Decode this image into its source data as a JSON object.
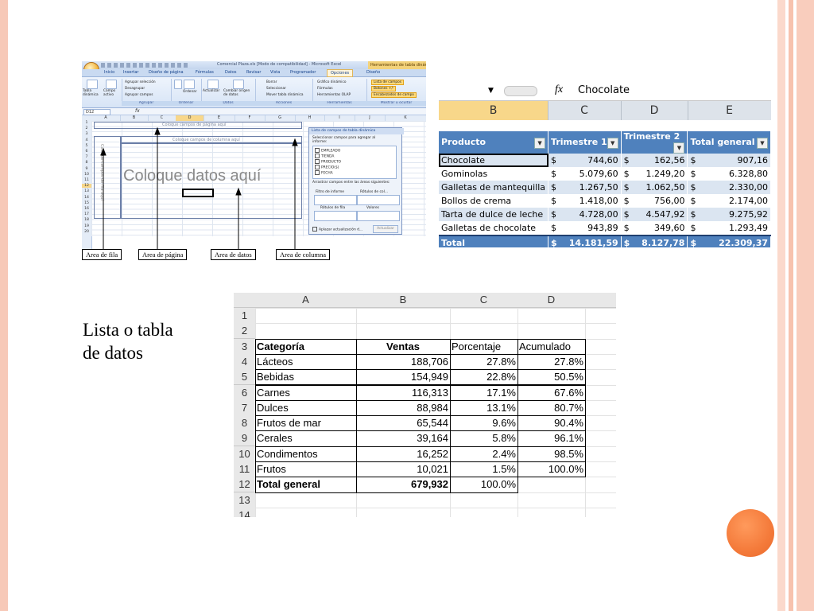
{
  "slide": {
    "side_text_line1": "Lista o tabla",
    "side_text_line2": "de datos",
    "accent_color": "#f47a3a",
    "border_color": "#f7c9b8"
  },
  "excel_pivot_setup": {
    "window_title": "Comercial Plaza.xls [Modo de compatibilidad] - Microsoft Excel",
    "context_tab": "Herramientas de tabla dinámica",
    "tabs": [
      "Inicio",
      "Insertar",
      "Diseño de página",
      "Fórmulas",
      "Datos",
      "Revisar",
      "Vista",
      "Programador",
      "Opciones",
      "Diseño"
    ],
    "active_tab": "Opciones",
    "ribbon": {
      "tabla_dinamica": "Tabla dinámica",
      "campo_activo": "Campo activo",
      "agrupar_seleccion": "Agrupar selección",
      "desagrupar": "Desagrupar",
      "agrupar_campos": "Agrupar campos",
      "ordenar": "Ordenar",
      "actualizar": "Actualizar",
      "cambiar_origen": "Cambiar origen de datos",
      "borrar": "Borrar",
      "seleccionar": "Seleccionar",
      "mover_tabla": "Mover tabla dinámica",
      "grafico_dinamico": "Gráfico dinámico",
      "formulas": "Fórmulas",
      "herramientas_olap": "Herramientas OLAP",
      "lista_campos": "Lista de campos",
      "botones": "Botones +/-",
      "encabezados": "Encabezados de campo",
      "groups": [
        "Agrupar",
        "Ordenar",
        "Datos",
        "Acciones",
        "Herramientas",
        "Mostrar u ocultar"
      ]
    },
    "name_box": "D12",
    "fx": "fx",
    "columns": [
      "A",
      "B",
      "C",
      "D",
      "E",
      "F",
      "G",
      "H",
      "I",
      "J",
      "K"
    ],
    "rows": [
      "1",
      "2",
      "3",
      "4",
      "5",
      "6",
      "7",
      "8",
      "9",
      "10",
      "11",
      "12",
      "13",
      "14",
      "15",
      "16",
      "17",
      "18",
      "19",
      "20"
    ],
    "page_placeholder": "Coloque campos de página aquí",
    "column_placeholder": "Coloque campos de columna aquí",
    "data_placeholder": "Coloque datos aquí",
    "row_placeholder": "Coloque campos de fila aquí",
    "field_list": {
      "title": "Lista de campos de tabla dinámica",
      "prompt": "Seleccionar campos para agregar al informe:",
      "fields": [
        "EMPLEADO",
        "TIENDA",
        "PRODUCTO",
        "PRECIO($)",
        "FECHA"
      ],
      "drag_prompt": "Arrastrar campos entre las áreas siguientes:",
      "filtro": "Filtro de informe",
      "rotulos_columna": "Rótulos de col...",
      "rotulos_fila": "Rótulos de fila",
      "valores": "Valores",
      "aplazar": "Aplazar actualización d...",
      "actualizar": "Actualizar"
    },
    "callouts": {
      "fila": "Area de fila",
      "pagina": "Area de página",
      "datos": "Area de datos",
      "columna": "Area de columna"
    }
  },
  "pivot_result": {
    "formula_value": "Chocolate",
    "fx": "fx",
    "columns": [
      "B",
      "C",
      "D",
      "E"
    ],
    "headers": [
      "Producto",
      "Trimestre 1",
      "Trimestre 2",
      "Total general"
    ],
    "rows": [
      {
        "producto": "Chocolate",
        "t1": "744,60",
        "t2": "162,56",
        "total": "907,16"
      },
      {
        "producto": "Gominolas",
        "t1": "5.079,60",
        "t2": "1.249,20",
        "total": "6.328,80"
      },
      {
        "producto": "Galletas de mantequilla",
        "t1": "1.267,50",
        "t2": "1.062,50",
        "total": "2.330,00"
      },
      {
        "producto": "Bollos de crema",
        "t1": "1.418,00",
        "t2": "756,00",
        "total": "2.174,00"
      },
      {
        "producto": "Tarta de dulce de leche",
        "t1": "4.728,00",
        "t2": "4.547,92",
        "total": "9.275,92"
      },
      {
        "producto": "Galletas de chocolate",
        "t1": "943,89",
        "t2": "349,60",
        "total": "1.293,49"
      }
    ],
    "total": {
      "producto": "Total",
      "t1": "14.181,59",
      "t2": "8.127,78",
      "total": "22.309,37"
    },
    "currency": "$"
  },
  "data_list": {
    "columns": [
      "A",
      "B",
      "C",
      "D"
    ],
    "row_numbers": [
      "1",
      "2",
      "3",
      "4",
      "5",
      "6",
      "7",
      "8",
      "9",
      "10",
      "11",
      "12",
      "13",
      "14"
    ],
    "headers": [
      "Categoría",
      "Ventas",
      "Porcentaje",
      "Acumulado"
    ],
    "rows": [
      {
        "categoria": "Lácteos",
        "ventas": "188,706",
        "porcentaje": "27.8%",
        "acumulado": "27.8%"
      },
      {
        "categoria": "Bebidas",
        "ventas": "154,949",
        "porcentaje": "22.8%",
        "acumulado": "50.5%"
      },
      {
        "categoria": "Carnes",
        "ventas": "116,313",
        "porcentaje": "17.1%",
        "acumulado": "67.6%"
      },
      {
        "categoria": "Dulces",
        "ventas": "88,984",
        "porcentaje": "13.1%",
        "acumulado": "80.7%"
      },
      {
        "categoria": "Frutos de mar",
        "ventas": "65,544",
        "porcentaje": "9.6%",
        "acumulado": "90.4%"
      },
      {
        "categoria": "Cerales",
        "ventas": "39,164",
        "porcentaje": "5.8%",
        "acumulado": "96.1%"
      },
      {
        "categoria": "Condimentos",
        "ventas": "16,252",
        "porcentaje": "2.4%",
        "acumulado": "98.5%"
      },
      {
        "categoria": "Frutos",
        "ventas": "10,021",
        "porcentaje": "1.5%",
        "acumulado": "100.0%"
      }
    ],
    "total": {
      "categoria": "Total general",
      "ventas": "679,932",
      "porcentaje": "100.0%"
    }
  }
}
